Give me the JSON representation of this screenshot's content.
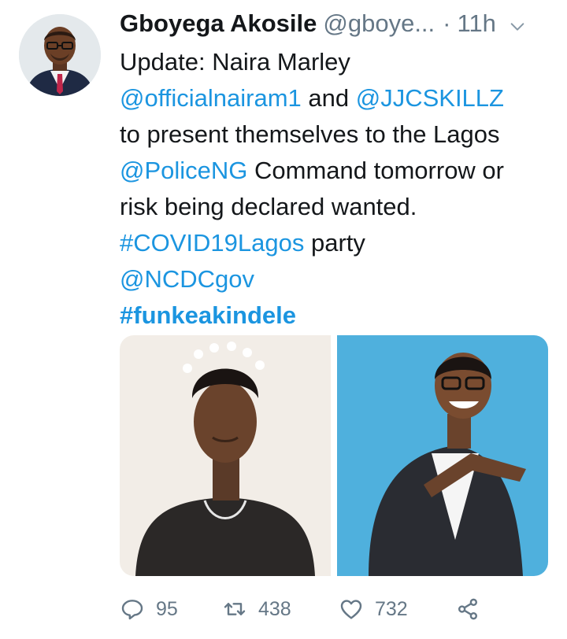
{
  "tweet": {
    "author_name": "Gboyega Akosile",
    "handle": "@gboye...",
    "separator": "·",
    "time": "11h",
    "icons": {
      "avatar": "author-avatar",
      "menu": "chevron-down-icon"
    },
    "text": {
      "line1": "Update: Naira Marley",
      "mention_nairam": "@officialnairam1",
      "and": " and ",
      "mention_jjc": "@JJCSKILLZ",
      "line3": "to present themselves to the Lagos",
      "mention_police": "@PoliceNG",
      "line4_rest": " Command tomorrow or",
      "line5": "risk being declared wanted.",
      "hashtag_covid": "#COVID19Lagos",
      "line6_rest": " party",
      "mention_ncdc": "@NCDCgov",
      "hashtag_funke": "#funkeakindele"
    },
    "actions": {
      "replies": "95",
      "retweets": "438",
      "likes": "732"
    },
    "colors": {
      "link": "#1b95e0",
      "muted": "#657786",
      "text": "#14171a"
    }
  }
}
